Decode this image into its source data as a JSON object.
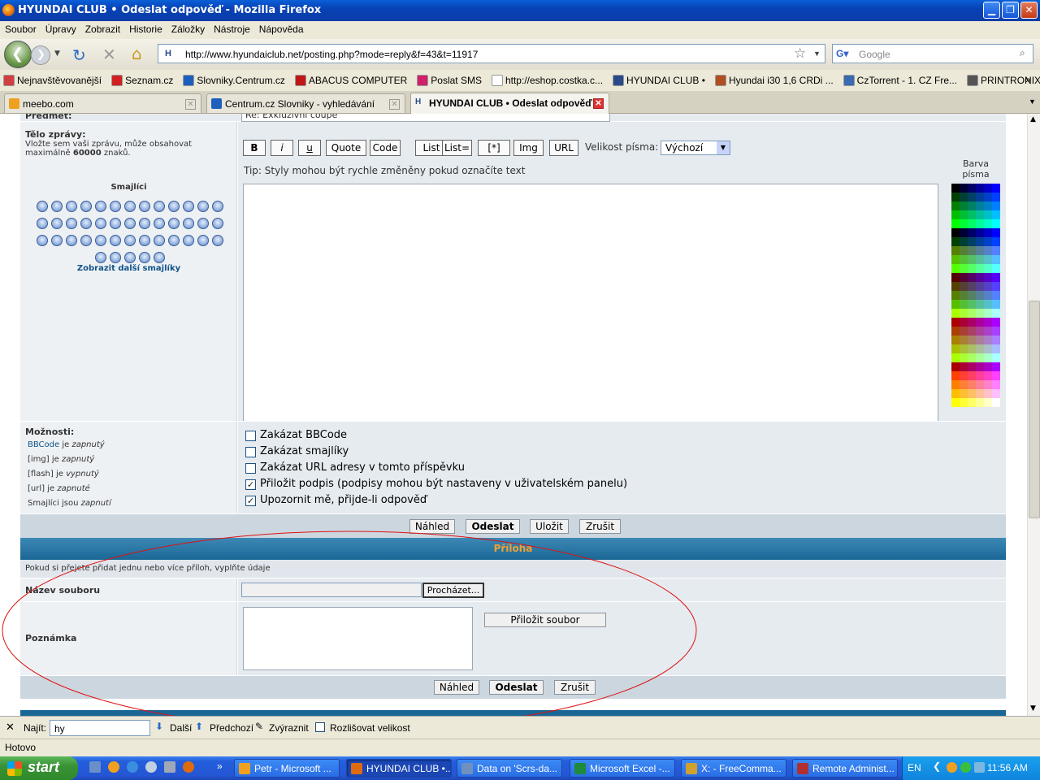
{
  "window": {
    "title": "HYUNDAI CLUB • Odeslat odpověď - Mozilla Firefox"
  },
  "menu": [
    "Soubor",
    "Úpravy",
    "Zobrazit",
    "Historie",
    "Záložky",
    "Nástroje",
    "Nápověda"
  ],
  "nav": {
    "url": "http://www.hyundaiclub.net/posting.php?mode=reply&f=43&t=11917",
    "search_placeholder": "Google"
  },
  "bookmarks": [
    {
      "label": "Nejnavštěvovanější",
      "color": "#d04040"
    },
    {
      "label": "Seznam.cz",
      "color": "#d02020"
    },
    {
      "label": "Slovniky.Centrum.cz",
      "color": "#1d5fbd"
    },
    {
      "label": "ABACUS COMPUTER",
      "color": "#c01818"
    },
    {
      "label": "Poslat SMS",
      "color": "#d0206a"
    },
    {
      "label": "http://eshop.costka.c...",
      "color": "#ffffff"
    },
    {
      "label": "HYUNDAI CLUB •",
      "color": "#2a4a8a"
    },
    {
      "label": "Hyundai i30 1,6 CRDi ...",
      "color": "#b05020"
    },
    {
      "label": "CzTorrent - 1. CZ Fre...",
      "color": "#3a6ab0"
    },
    {
      "label": "PRINTRONIX, INTERM...",
      "color": "#555555"
    }
  ],
  "tabs": [
    {
      "label": "meebo.com"
    },
    {
      "label": "Centrum.cz Slovniky - vyhledávání"
    },
    {
      "label": "HYUNDAI CLUB • Odeslat odpověď"
    }
  ],
  "form": {
    "subject_label": "Předmět:",
    "subject_value": "Re: Exkluzivní coupe",
    "body_label": "Tělo zprávy:",
    "body_help_1": "Vložte sem vaši zprávu, může obsahovat",
    "body_help_2a": "maximálně ",
    "body_help_2b": "60000",
    "body_help_2c": " znaků.",
    "smilies_title": "Smajlíci",
    "more_smilies": "Zobrazit další smajlíky",
    "bbcode_buttons": [
      "B",
      "i",
      "u",
      "Quote",
      "Code",
      "List",
      "List=",
      "[*]",
      "Img",
      "URL"
    ],
    "font_size_label": "Velikost písma:",
    "font_size_value": "Výchozí",
    "tip": "Tip: Styly mohou být rychle změněny pokud označíte text",
    "color_label_1": "Barva",
    "color_label_2": "písma",
    "options_label": "Možnosti:",
    "options_status": [
      {
        "a": "BBCode",
        "b": " je ",
        "c": "zapnutý"
      },
      {
        "a": "[img]",
        "b": " je ",
        "c": "zapnutý"
      },
      {
        "a": "[flash]",
        "b": " je ",
        "c": "vypnutý"
      },
      {
        "a": "[url]",
        "b": " je ",
        "c": "zapnuté"
      },
      {
        "a": "Smajlíci",
        "b": " jsou ",
        "c": "zapnutí"
      }
    ],
    "checkboxes": [
      {
        "label": "Zakázat BBCode",
        "checked": "☐"
      },
      {
        "label": "Zakázat smajlíky",
        "checked": "☐"
      },
      {
        "label": "Zakázat URL adresy v tomto příspěvku",
        "checked": "☐"
      },
      {
        "label": "Přiložit podpis (podpisy mohou být nastaveny v uživatelském panelu)",
        "checked": "✓"
      },
      {
        "label": "Upozornit mě, přijde-li odpověď",
        "checked": "✓"
      }
    ],
    "buttons_1": [
      "Náhled",
      "Odeslat",
      "Uložit",
      "Zrušit"
    ],
    "attach_header": "Příloha",
    "attach_help": "Pokud si přejete přidat jednu nebo více příloh, vyplňte údaje",
    "filename_label": "Název souboru",
    "browse_button": "Procházet...",
    "comment_label": "Poznámka",
    "attach_button": "Přiložit soubor",
    "buttons_2": [
      "Náhled",
      "Odeslat",
      "Zrušit"
    ]
  },
  "findbar": {
    "label": "Najít:",
    "value": "hy",
    "next": "Další",
    "prev": "Předchozí",
    "highlight": "Zvýraznit",
    "match_case": "Rozlišovat velikost"
  },
  "status": {
    "text": "Hotovo"
  },
  "taskbar": {
    "start": "start",
    "tasks": [
      {
        "label": "Petr - Microsoft ...",
        "color": "#f0a020"
      },
      {
        "label": "HYUNDAI CLUB •...",
        "color": "#e06a10"
      },
      {
        "label": "Data on 'Scrs-da...",
        "color": "#7090c0"
      },
      {
        "label": "Microsoft Excel -...",
        "color": "#1f8a3a"
      },
      {
        "label": "X: - FreeComma...",
        "color": "#d0a030"
      },
      {
        "label": "Remote Administ...",
        "color": "#b03030"
      }
    ],
    "lang": "EN",
    "clock": "11:56 AM"
  }
}
